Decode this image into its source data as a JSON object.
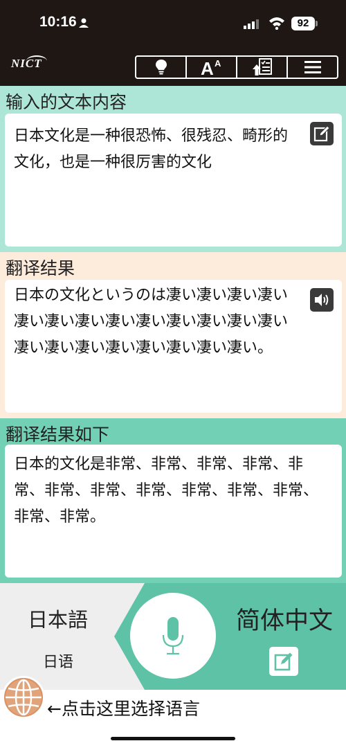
{
  "status_bar": {
    "time": "10:16",
    "battery": "92"
  },
  "header": {
    "logo": "NICT",
    "toolbar": [
      "hint-lightbulb-icon",
      "font-size-icon",
      "upload-list-icon",
      "menu-icon"
    ]
  },
  "input_section": {
    "title": "输入的文本内容",
    "text": "日本文化是一种很恐怖、很残忍、畸形的文化，也是一种很厉害的文化"
  },
  "result_section": {
    "title": "翻译结果",
    "text": "日本の文化というのは凄い凄い凄い凄い凄い凄い凄い凄い凄い凄い凄い凄い凄い凄い凄い凄い凄い凄い凄い凄い凄い。"
  },
  "back_translation_section": {
    "title": "翻译结果如下",
    "text": "日本的文化是非常、非常、非常、非常、非常、非常、非常、非常、非常、非常、非常、非常、非常。"
  },
  "languages": {
    "source": "日本語",
    "source_sub": "日语",
    "target": "简体中文"
  },
  "footer": {
    "hint": "←点击这里选择语言"
  },
  "colors": {
    "header_bg": "#1f1714",
    "input_bg": "#ade6d7",
    "result_bg": "#fdebdc",
    "back_bg": "#72d0b5",
    "target_lang_bg": "#5dc2a6",
    "globe": "#e0a37a"
  }
}
